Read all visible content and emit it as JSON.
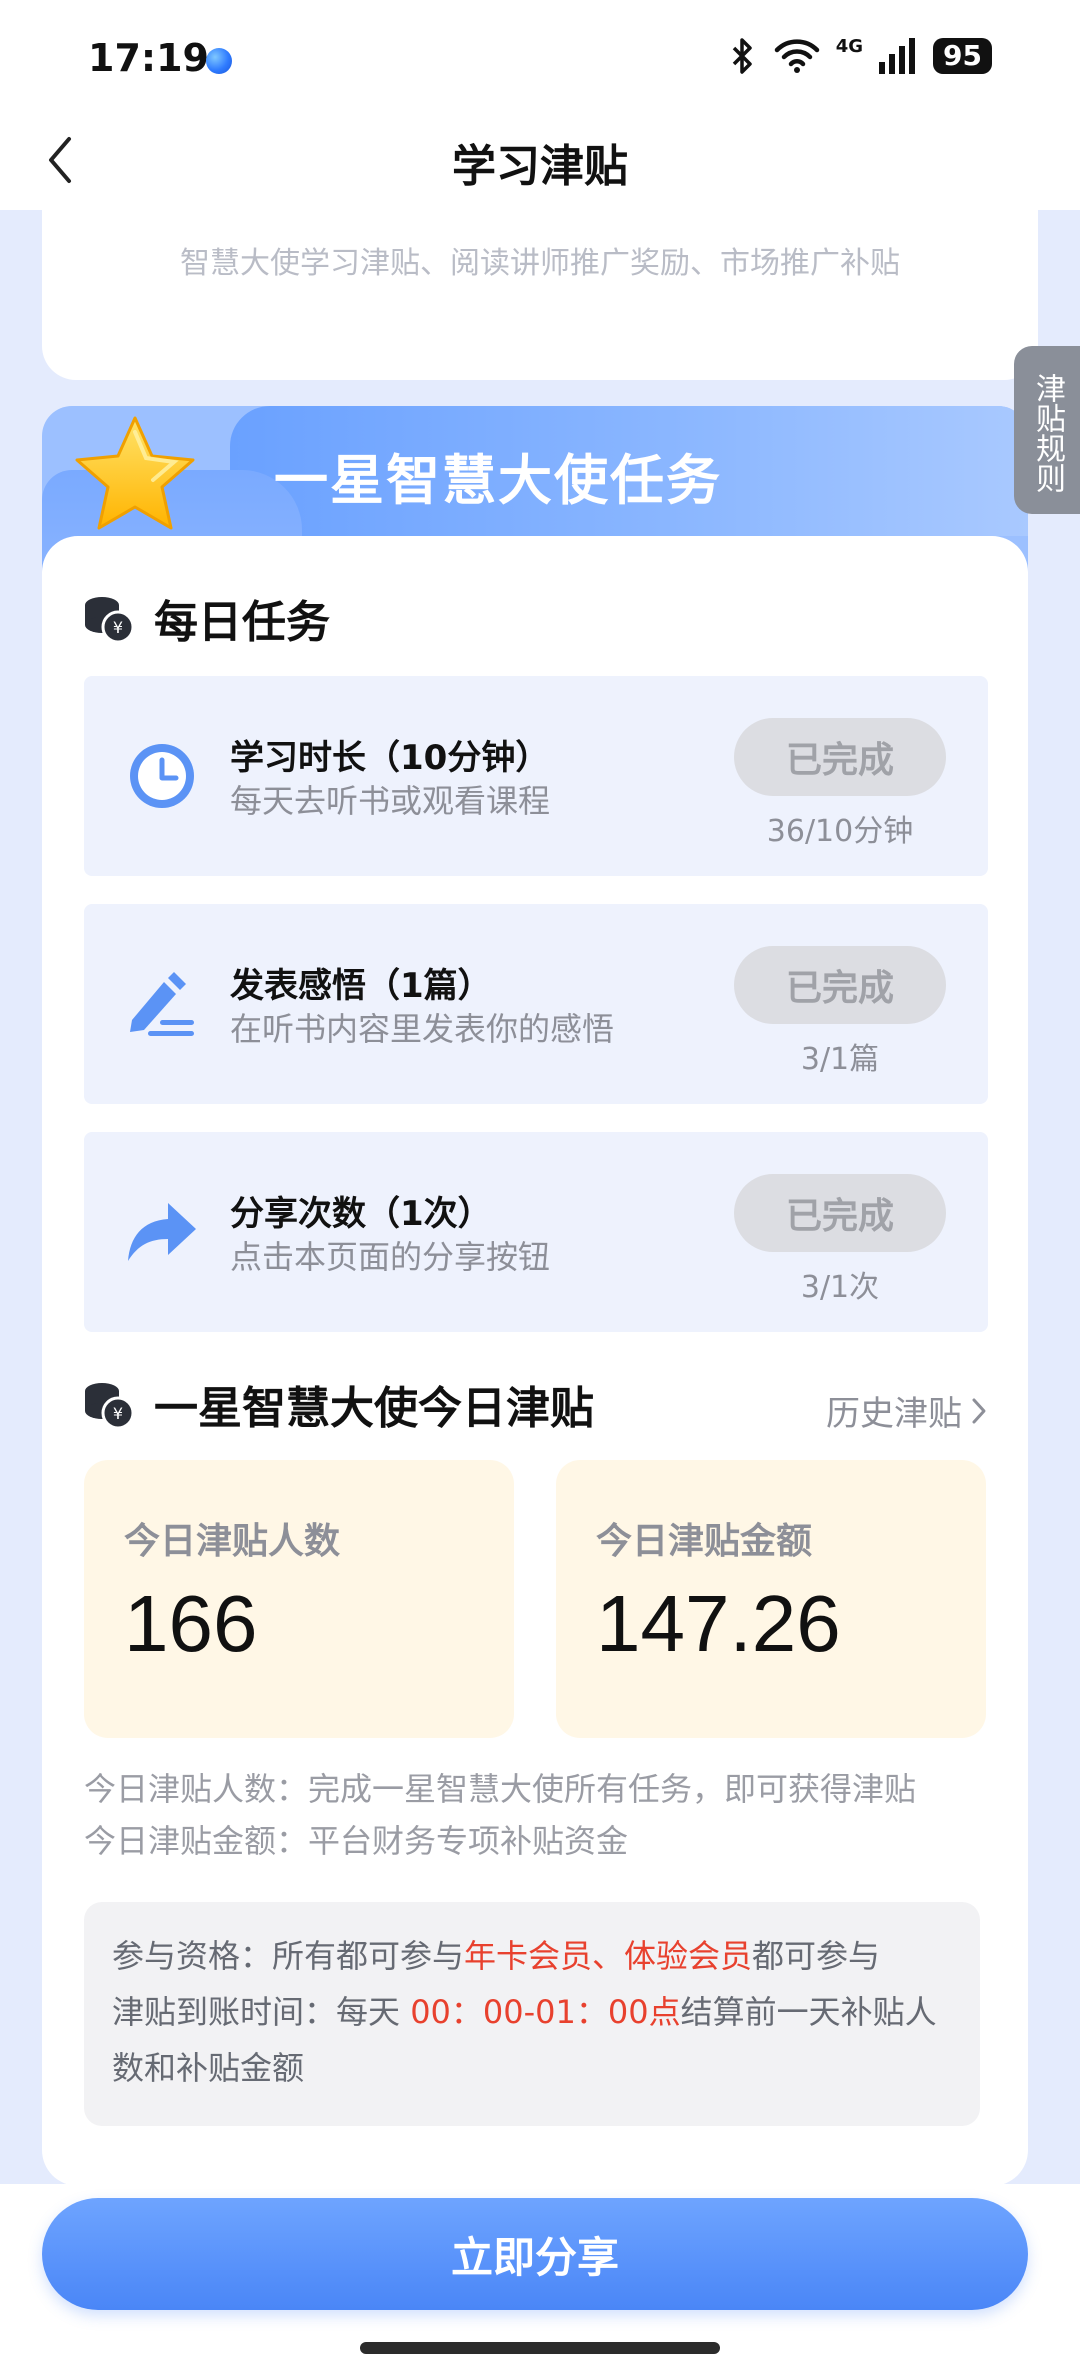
{
  "status_bar": {
    "time": "17:19",
    "network": "4G",
    "battery": "95"
  },
  "header": {
    "title": "学习津贴"
  },
  "top_card": {
    "subtitle": "智慧大使学习津贴、阅读讲师推广奖励、市场推广补贴"
  },
  "side_tab": {
    "label": "津贴规则"
  },
  "banner": {
    "title": "一星智慧大使任务"
  },
  "daily": {
    "title": "每日任务",
    "tasks": [
      {
        "name": "学习时长（10分钟）",
        "desc": "每天去听书或观看课程",
        "status": "已完成",
        "progress": "36/10分钟"
      },
      {
        "name": "发表感悟（1篇）",
        "desc": "在听书内容里发表你的感悟",
        "status": "已完成",
        "progress": "3/1篇"
      },
      {
        "name": "分享次数（1次）",
        "desc": "点击本页面的分享按钮",
        "status": "已完成",
        "progress": "3/1次"
      }
    ]
  },
  "allowance": {
    "title": "一星智慧大使今日津贴",
    "history_link": "历史津贴",
    "count_label": "今日津贴人数",
    "count_value": "166",
    "amount_label": "今日津贴金额",
    "amount_value": "147.26",
    "note1": "今日津贴人数：完成一星智慧大使所有任务，即可获得津贴",
    "note2": "今日津贴金额：平台财务专项补贴资金"
  },
  "info": {
    "line1_prefix": "参与资格：所有都可参与",
    "line1_highlight": "年卡会员、体验会员",
    "line1_suffix": "都可参与",
    "line2_prefix": "津贴到账时间：每天 ",
    "line2_highlight": "00：00-01：00点",
    "line2_suffix": "结算前一天补贴人数和补贴金额"
  },
  "share_button": {
    "label": "立即分享"
  },
  "colors": {
    "accent": "#4a86f7",
    "highlight": "#e8412e",
    "stat_bg": "#fff7e6",
    "task_bg": "#eef2fd"
  }
}
